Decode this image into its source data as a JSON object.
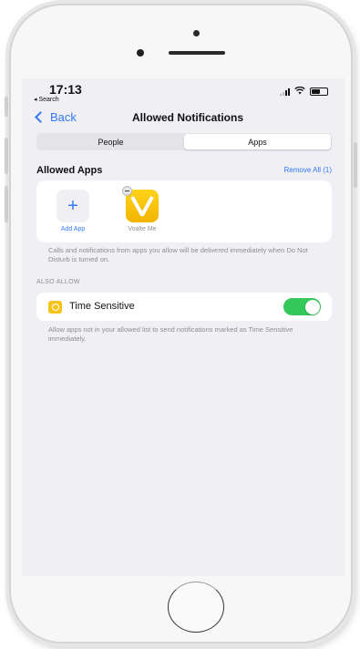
{
  "status_bar": {
    "time": "17:13",
    "back_app": "◂ Search"
  },
  "nav": {
    "back_label": "Back",
    "title": "Allowed Notifications"
  },
  "segments": [
    "People",
    "Apps"
  ],
  "allowed_apps": {
    "header": "Allowed Apps",
    "remove_all": "Remove All (1)",
    "add_app_label": "Add App",
    "apps": [
      {
        "name": "Voalte Me",
        "icon": "v-letter-icon",
        "color": "#f5c000"
      }
    ],
    "footnote": "Calls and notifications from apps you allow will be delivered immediately when Do Not Disturb is turned on."
  },
  "also_allow": {
    "header": "ALSO ALLOW",
    "time_sensitive_label": "Time Sensitive",
    "time_sensitive_on": true,
    "footnote": "Allow apps not in your allowed list to send notifications marked as Time Sensitive immediately."
  },
  "colors": {
    "accent": "#3478f6",
    "toggle_on": "#34c759",
    "background": "#efeff4"
  }
}
